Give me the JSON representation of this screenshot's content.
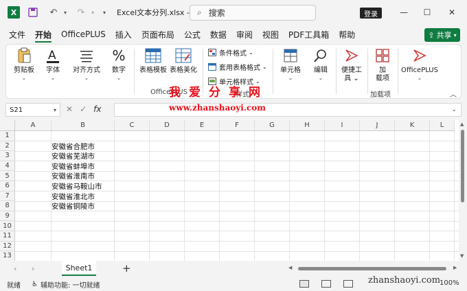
{
  "titlebar": {
    "file_title": "Excel文本分列.xlsx  -  Ex...",
    "search_placeholder": "搜索",
    "login_label": "登录",
    "minimize": "—",
    "maximize": "☐",
    "close": "✕"
  },
  "menu": {
    "tabs": [
      "文件",
      "开始",
      "OfficePLUS",
      "插入",
      "页面布局",
      "公式",
      "数据",
      "审阅",
      "视图",
      "PDF工具箱",
      "帮助"
    ],
    "share_label": "共享"
  },
  "ribbon": {
    "clipboard": "剪贴板",
    "font": "字体",
    "alignment": "对齐方式",
    "number": "数字",
    "table_template": "表格模板",
    "table_beautify": "表格美化",
    "group_officeplus_left": "OfficePLUS",
    "conditional_format": "条件格式",
    "format_as_table": "套用表格格式",
    "cell_style": "单元格样式",
    "group_style": "样式",
    "cells": "单元格",
    "editing": "编辑",
    "convenience_tools_1": "便捷工",
    "convenience_tools_2": "具",
    "addins_1": "加",
    "addins_2": "载项",
    "group_addins": "加载项",
    "officeplus": "OfficePLUS"
  },
  "watermark": {
    "title": "我爱分享网",
    "url": "www.zhanshaoyi.com",
    "status_url": "zhanshaoyi.com"
  },
  "formula": {
    "namebox": "S21",
    "cancel": "✕",
    "enter": "✓",
    "fx": "fx",
    "value": ""
  },
  "grid": {
    "columns": [
      "A",
      "B",
      "C",
      "D",
      "E",
      "F",
      "G",
      "H",
      "I",
      "J",
      "K",
      "L"
    ],
    "rows": [
      "1",
      "2",
      "3",
      "4",
      "5",
      "6",
      "7",
      "8",
      "9",
      "10",
      "11",
      "12",
      "13"
    ],
    "cells_b": [
      "安徽省合肥市",
      "安徽省芜湖市",
      "安徽省蚌埠市",
      "安徽省淮南市",
      "安徽省马鞍山市",
      "安徽省淮北市",
      "安徽省铜陵市"
    ]
  },
  "sheets": {
    "active": "Sheet1",
    "add": "+"
  },
  "status": {
    "ready": "就绪",
    "accessibility": "辅助功能: 一切就绪",
    "zoom": "100%"
  }
}
